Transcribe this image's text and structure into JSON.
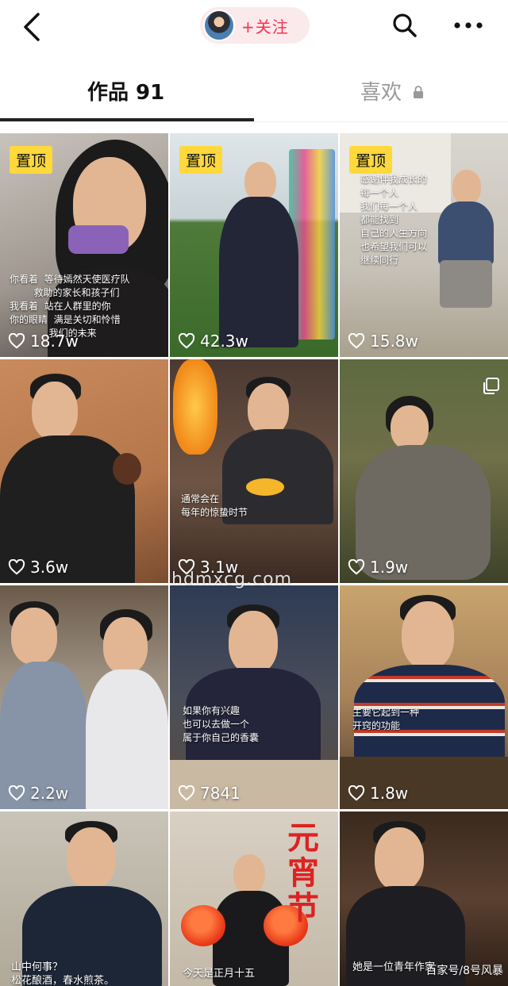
{
  "header": {
    "follow_label": "+关注"
  },
  "tabs": {
    "works_label": "作品 91",
    "likes_label": "喜欢"
  },
  "posts": [
    {
      "pinned": true,
      "pin_label": "置顶",
      "likes": "18.7w",
      "overlay": "你看着  等待嫣然天使医疗队\n        救助的家长和孩子们\n我看着  站在人群里的你\n你的眼睛  满是关切和怜惜\n             我们的未来"
    },
    {
      "pinned": true,
      "pin_label": "置顶",
      "likes": "42.3w"
    },
    {
      "pinned": true,
      "pin_label": "置顶",
      "likes": "15.8w",
      "overlay": "感谢伴我成长的\n每一个人\n我们每一个人\n都能找到\n自己的人生方向\n也希望我们可以\n继续同行"
    },
    {
      "likes": "3.6w"
    },
    {
      "likes": "3.1w",
      "overlay": "通常会在\n每年的惊蛰时节"
    },
    {
      "likes": "1.9w"
    },
    {
      "likes": "2.2w"
    },
    {
      "likes": "7841",
      "overlay": "如果你有兴趣\n也可以去做一个\n属于你自己的香囊"
    },
    {
      "likes": "1.8w",
      "overlay": "主要它起到一种\n开窍的功能"
    },
    {
      "overlay": "山中何事？\n松花酿酒，春水煎茶。"
    },
    {
      "title": "元宵节",
      "overlay": "今天是正月十五"
    },
    {
      "overlay": "她是一位青年作家"
    }
  ],
  "watermarks": {
    "middle": "hdmxcg.com",
    "bottom_right": "百家号/8号风暴"
  },
  "colors": {
    "accent": "#ff2e4d",
    "pin": "#ffd83b",
    "follow_bg": "#fbeaec"
  }
}
